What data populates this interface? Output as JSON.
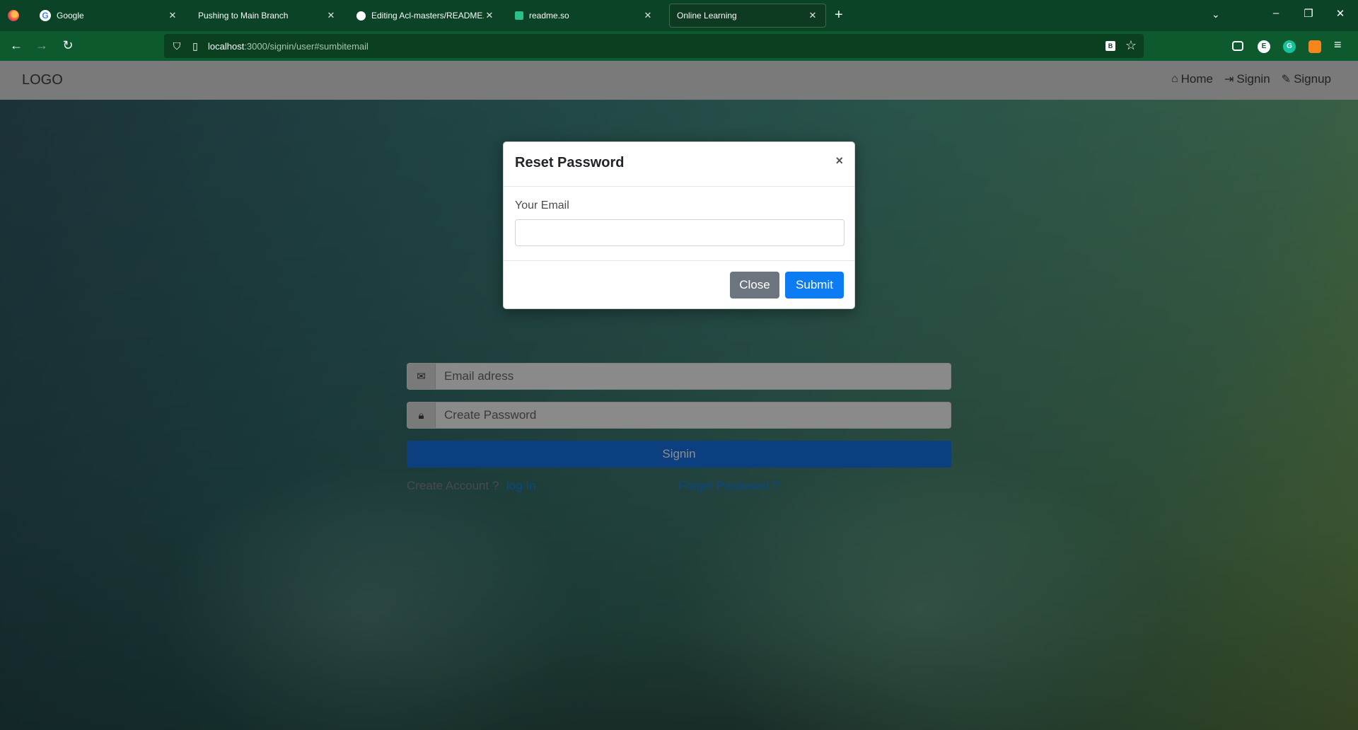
{
  "browser": {
    "tabs": [
      {
        "title": "Google",
        "icon": "G"
      },
      {
        "title": "Pushing to Main Branch",
        "icon": ""
      },
      {
        "title": "Editing Acl-masters/README.m",
        "icon": "github"
      },
      {
        "title": "readme.so",
        "icon": "readme"
      },
      {
        "title": "Online Learning",
        "icon": ""
      }
    ],
    "url_host": "localhost",
    "url_rest": ":3000/signin/user#sumbitemail",
    "new_tab": "+",
    "extensions": [
      "E",
      "G"
    ]
  },
  "header": {
    "logo": "LOGO",
    "nav": [
      {
        "label": "Home",
        "icon": "home-icon"
      },
      {
        "label": "Signin",
        "icon": "signin-icon"
      },
      {
        "label": "Signup",
        "icon": "edit-icon"
      }
    ]
  },
  "signin_form": {
    "email_placeholder": "Email adress",
    "password_placeholder": "Create Password",
    "submit_label": "Signin",
    "create_account_label": "Create Account ?",
    "login_link": "log In",
    "forgot_link": "Forget Password ?"
  },
  "modal": {
    "title": "Reset Password",
    "close_x": "×",
    "email_label": "Your Email",
    "email_value": "",
    "close_label": "Close",
    "submit_label": "Submit"
  },
  "colors": {
    "browser_chrome": "#0b4326",
    "primary": "#0d7cf2",
    "secondary": "#6c757d"
  }
}
